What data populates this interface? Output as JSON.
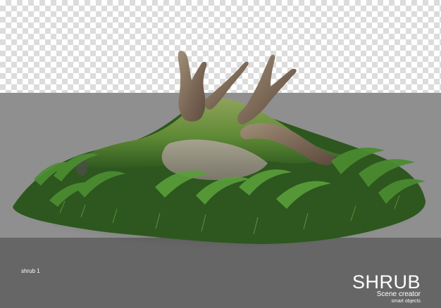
{
  "caption": "shrub 1",
  "branding": {
    "title": "SHRUB",
    "subtitle": "Scene creator",
    "tagline": "smart objects"
  },
  "colors": {
    "top_grid_light": "#ffffff",
    "top_grid_dark": "#dcdcdc",
    "middle_band": "#8f8f8f",
    "bottom_band": "#666666",
    "moss": "#6c8f3f",
    "fern": "#3f7f2b",
    "wood": "#7f6c58",
    "rock": "#8d887a"
  }
}
